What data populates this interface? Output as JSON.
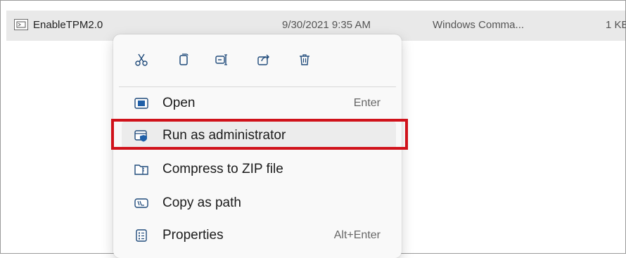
{
  "file": {
    "name": "EnableTPM2.0",
    "date_modified": "9/30/2021 9:35 AM",
    "type": "Windows Comma...",
    "size": "1 KB",
    "icon": "batch-file-icon"
  },
  "context_menu": {
    "toolbar": [
      {
        "name": "cut",
        "icon": "scissors-icon"
      },
      {
        "name": "copy",
        "icon": "copy-icon"
      },
      {
        "name": "rename",
        "icon": "rename-icon"
      },
      {
        "name": "share",
        "icon": "share-icon"
      },
      {
        "name": "delete",
        "icon": "trash-icon"
      }
    ],
    "items": [
      {
        "label": "Open",
        "shortcut": "Enter",
        "icon": "open-icon"
      },
      {
        "label": "Run as administrator",
        "shortcut": "",
        "icon": "shield-run-icon"
      },
      {
        "label": "Compress to ZIP file",
        "shortcut": "",
        "icon": "zip-folder-icon"
      },
      {
        "label": "Copy as path",
        "shortcut": "",
        "icon": "path-icon"
      },
      {
        "label": "Properties",
        "shortcut": "Alt+Enter",
        "icon": "properties-icon"
      }
    ],
    "highlighted_item": "Run as administrator"
  },
  "colors": {
    "accent": "#0067c0",
    "highlight_border": "#d0121b",
    "selected_row": "#e9e9e9"
  }
}
